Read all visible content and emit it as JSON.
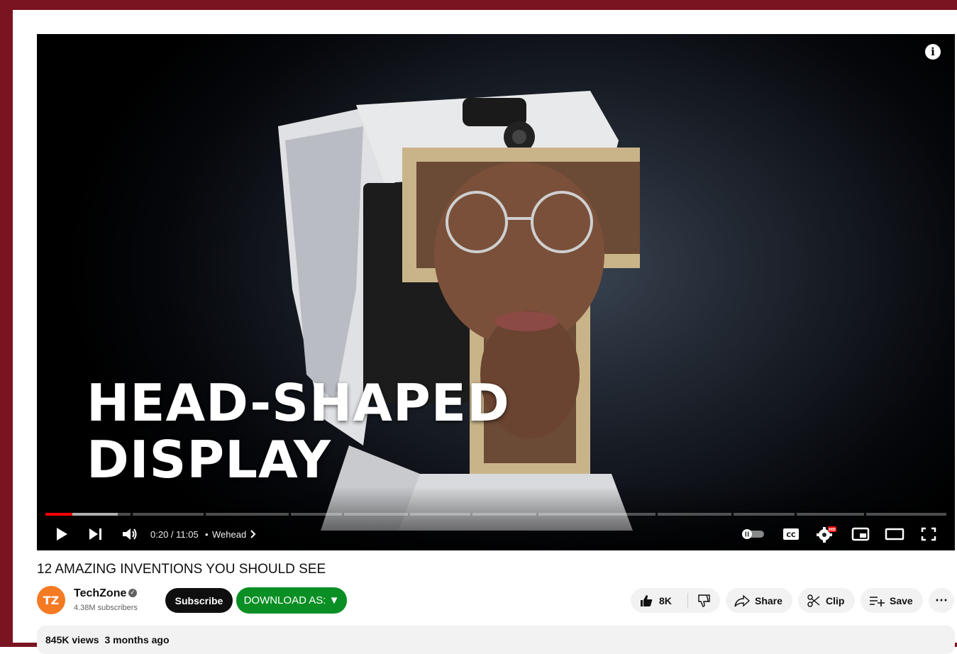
{
  "player": {
    "overlay_line1": "HEAD-SHAPED",
    "overlay_line2": "DISPLAY",
    "current_time": "0:20",
    "duration": "11:05",
    "time_display": "0:20 / 11:05",
    "chapter": "Wehead",
    "chapter_separator": "•",
    "progress_played_fraction": 0.03,
    "progress_buffered_fraction": 0.08,
    "hd_badge": "HD",
    "info_icon": "info-icon",
    "cc_label": "CC"
  },
  "video": {
    "title": "12 AMAZING INVENTIONS YOU SHOULD SEE"
  },
  "channel": {
    "avatar_initials": "TZ",
    "name": "TechZone",
    "subscribers": "4.38M subscribers",
    "subscribe_label": "Subscribe",
    "download_label": "DOWNLOAD AS: ▼"
  },
  "actions": {
    "like_count": "8K",
    "share_label": "Share",
    "clip_label": "Clip",
    "save_label": "Save",
    "more_label": "⋯"
  },
  "description": {
    "views": "845K views",
    "age": "3 months ago"
  },
  "colors": {
    "frame": "#7a1420",
    "progress_red": "#ff0000",
    "download_green": "#0a8f24",
    "avatar_orange": "#f47a23"
  }
}
